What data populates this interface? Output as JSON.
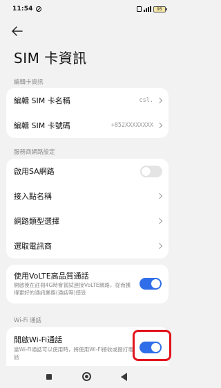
{
  "status_bar": {
    "time": "11:54",
    "battery": "95"
  },
  "header": {
    "back_icon": "arrow-left-icon",
    "title": "SIM 卡資訊"
  },
  "sections": {
    "edit_sim": {
      "header": "編輯卡資訊",
      "items": [
        {
          "label": "編輯 SIM 卡名稱",
          "value": "csl."
        },
        {
          "label": "編輯 SIM 卡號碼",
          "value": "+852XXXXXXXX"
        }
      ]
    },
    "carrier": {
      "header": "服務商網路設定",
      "items": [
        {
          "label": "啟用SA網路",
          "toggle": "off"
        },
        {
          "label": "接入點名稱"
        },
        {
          "label": "網路類型選擇"
        },
        {
          "label": "選取電訊商"
        }
      ]
    },
    "volte": {
      "label": "使用VoLTE高品質通話",
      "description": "開啟後在註冊4G時會嘗試連接VoLTE網路，從而獲得更好的通訊業務(通話等)感受",
      "toggle": "on"
    },
    "wifi": {
      "header": "Wi-Fi 通話",
      "label": "開啟Wi-Fi通話",
      "description": "當Wi-Fi通話可以使用時，將使用Wi-Fi接收或撥打電話",
      "toggle": "on"
    }
  },
  "colors": {
    "accent": "#2f6ee8",
    "highlight": "#e3141c",
    "background": "#f2f2f2"
  },
  "nav_bar": {
    "icons": [
      "recent-apps-icon",
      "home-icon",
      "back-triangle-icon"
    ]
  }
}
